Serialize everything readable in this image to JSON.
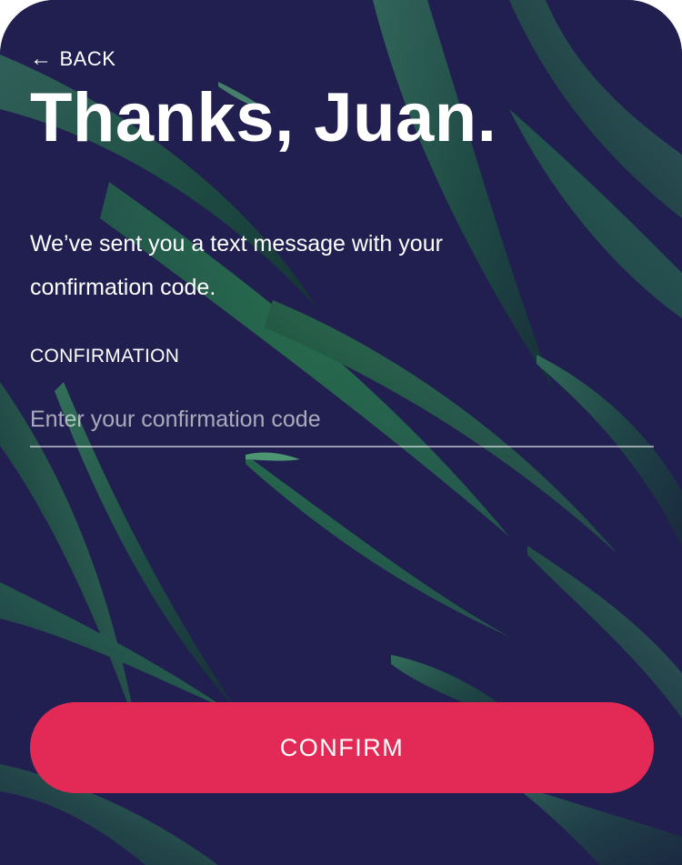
{
  "nav": {
    "back_arrow": "←",
    "back_label": "BACK"
  },
  "header": {
    "title": "Thanks, Juan."
  },
  "body": {
    "message": "We’ve sent you a text message  with your confirmation code."
  },
  "form": {
    "confirmation_label": "CONFIRMATION",
    "confirmation_placeholder": "Enter your confirmation code",
    "confirmation_value": ""
  },
  "actions": {
    "confirm_label": "CONFIRM"
  },
  "theme": {
    "background": "#211f4f",
    "leaf_green": "#2f8a4e",
    "accent": "#e32a57",
    "text": "#ffffff"
  }
}
